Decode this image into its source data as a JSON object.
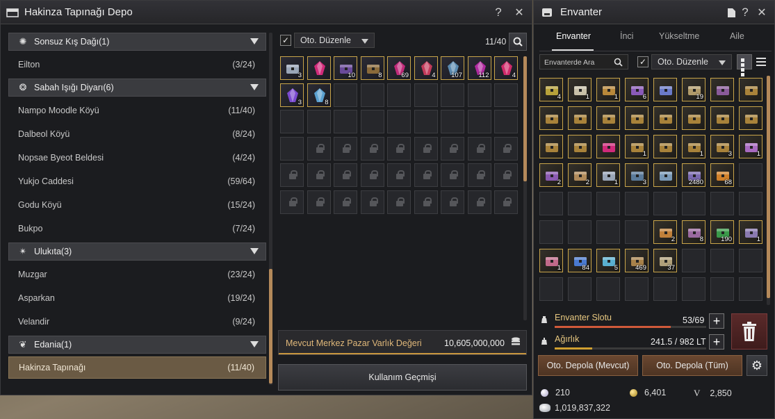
{
  "depo": {
    "title": "Hakinza Tapınağı Depo",
    "help_icon": "?",
    "close_icon": "✕",
    "regions": [
      {
        "name": "Sonsuz Kış Dağı(1)",
        "icon": "snowflake-icon",
        "cities": [
          {
            "name": "Eilton",
            "count": "(3/24)"
          }
        ]
      },
      {
        "name": "Sabah Işığı Diyarı(6)",
        "icon": "sun-emblem-icon",
        "cities": [
          {
            "name": "Nampo Moodle Köyü",
            "count": "(11/40)"
          },
          {
            "name": "Dalbeol Köyü",
            "count": "(8/24)"
          },
          {
            "name": "Nopsae Byeot Beldesi",
            "count": "(4/24)"
          },
          {
            "name": "Yukjo Caddesi",
            "count": "(59/64)"
          },
          {
            "name": "Godu Köyü",
            "count": "(15/24)"
          },
          {
            "name": "Bukpo",
            "count": "(7/24)"
          }
        ]
      },
      {
        "name": "Ulukıta(3)",
        "icon": "star-compass-icon",
        "cities": [
          {
            "name": "Muzgar",
            "count": "(23/24)"
          },
          {
            "name": "Asparkan",
            "count": "(19/24)"
          },
          {
            "name": "Velandir",
            "count": "(9/24)"
          }
        ]
      },
      {
        "name": "Edania(1)",
        "icon": "swirl-emblem-icon",
        "cities": [
          {
            "name": "Hakinza Tapınağı",
            "count": "(11/40)",
            "selected": true
          }
        ]
      }
    ],
    "auto_sort_label": "Oto. Düzenle",
    "slot_count": "11/40",
    "items": [
      {
        "qty": "3",
        "color": "#9aa6b8",
        "icon": "chest-icon"
      },
      {
        "qty": "",
        "color": "#d02a7a",
        "icon": "crystal-icon"
      },
      {
        "qty": "10",
        "color": "#6a4a9a",
        "icon": "box-icon"
      },
      {
        "qty": "8",
        "color": "#8a6a3a",
        "icon": "lantern-icon"
      },
      {
        "qty": "69",
        "color": "#c02a7a",
        "icon": "shard-icon"
      },
      {
        "qty": "4",
        "color": "#c23a5a",
        "icon": "crystal-icon"
      },
      {
        "qty": "107",
        "color": "#5a8ab0",
        "icon": "shard-icon"
      },
      {
        "qty": "112",
        "color": "#b02aa0",
        "icon": "shard-icon"
      },
      {
        "qty": "4",
        "color": "#d02a6a",
        "icon": "shard-icon"
      },
      {
        "qty": "3",
        "color": "#7a4ad0",
        "icon": "shard-icon"
      },
      {
        "qty": "8",
        "color": "#5aa0d0",
        "icon": "shard-icon"
      }
    ],
    "open_slots": 40,
    "unlocked_slots": 28,
    "market_value_label": "Mevcut Merkez Pazar Varlık Değeri",
    "market_value": "10,605,000,000",
    "history_button": "Kullanım Geçmişi"
  },
  "envanter": {
    "title": "Envanter",
    "tabs": [
      "Envanter",
      "İnci",
      "Yükseltme",
      "Aile"
    ],
    "search_placeholder": "Envanterde Ara",
    "auto_sort_label": "Oto. Düzenle",
    "items": [
      {
        "qty": "4",
        "color": "#b8a23a"
      },
      {
        "qty": "1",
        "color": "#c8c0a8"
      },
      {
        "qty": "1",
        "color": "#b8883a"
      },
      {
        "qty": "6",
        "color": "#8a5ab8"
      },
      {
        "qty": "",
        "color": "#6a7ac8"
      },
      {
        "qty": "19",
        "color": "#b09a6a"
      },
      {
        "qty": "",
        "color": "#8a5a9a"
      },
      {
        "qty": "",
        "color": "#a8823a"
      },
      {
        "qty": "",
        "color": "#a8823a"
      },
      {
        "qty": "",
        "color": "#a8823a"
      },
      {
        "qty": "",
        "color": "#a8823a"
      },
      {
        "qty": "",
        "color": "#a8823a"
      },
      {
        "qty": "",
        "color": "#a8823a"
      },
      {
        "qty": "",
        "color": "#a8823a"
      },
      {
        "qty": "",
        "color": "#a8823a"
      },
      {
        "qty": "",
        "color": "#a8823a"
      },
      {
        "qty": "",
        "color": "#a8823a"
      },
      {
        "qty": "",
        "color": "#a8823a"
      },
      {
        "qty": "",
        "color": "#d02a7a"
      },
      {
        "qty": "1",
        "color": "#a8823a"
      },
      {
        "qty": "",
        "color": "#a8823a"
      },
      {
        "qty": "1",
        "color": "#a8823a"
      },
      {
        "qty": "3",
        "color": "#a8823a"
      },
      {
        "qty": "1",
        "color": "#a86ac0"
      },
      {
        "qty": "2",
        "color": "#8a5ab0"
      },
      {
        "qty": "2",
        "color": "#b08a5a"
      },
      {
        "qty": "1",
        "color": "#9aa6b8"
      },
      {
        "qty": "3",
        "color": "#5a7a9a"
      },
      {
        "qty": "",
        "color": "#7a9ab8"
      },
      {
        "qty": "2480",
        "color": "#7a6ab0"
      },
      {
        "qty": "68",
        "color": "#d0802a"
      },
      {
        "qty": "",
        "color": ""
      },
      {
        "qty": "",
        "color": ""
      },
      {
        "qty": "",
        "color": ""
      },
      {
        "qty": "",
        "color": ""
      },
      {
        "qty": "",
        "color": ""
      },
      {
        "qty": "",
        "color": ""
      },
      {
        "qty": "",
        "color": ""
      },
      {
        "qty": "",
        "color": ""
      },
      {
        "qty": "",
        "color": ""
      },
      {
        "qty": "",
        "color": ""
      },
      {
        "qty": "",
        "color": ""
      },
      {
        "qty": "",
        "color": ""
      },
      {
        "qty": "",
        "color": ""
      },
      {
        "qty": "2",
        "color": "#c0803a"
      },
      {
        "qty": "8",
        "color": "#9a6aa0"
      },
      {
        "qty": "190",
        "color": "#3a9a4a"
      },
      {
        "qty": "1",
        "color": "#8a7ab0"
      },
      {
        "qty": "1",
        "color": "#c06a8a"
      },
      {
        "qty": "84",
        "color": "#4a7ad0"
      },
      {
        "qty": "5",
        "color": "#5ab0d0"
      },
      {
        "qty": "469",
        "color": "#a8824a"
      },
      {
        "qty": "37",
        "color": "#b0a07a"
      },
      {
        "qty": "",
        "color": ""
      },
      {
        "qty": "",
        "color": ""
      },
      {
        "qty": "",
        "color": ""
      }
    ],
    "slot_label": "Envanter Slotu",
    "slot_value": "53/69",
    "slot_fraction": 0.768,
    "weight_label": "Ağırlık",
    "weight_value": "241.5 / 982 LT",
    "weight_fraction": 0.246,
    "auto_depot_current": "Oto. Depola (Mevcut)",
    "auto_depot_all": "Oto. Depola (Tüm)",
    "pearl": "210",
    "gold_coin": "6,401",
    "valor": "2,850",
    "silver": "1,019,837,322",
    "valor_symbol": "V"
  },
  "colors": {
    "accent": "#b4895a",
    "slot_fill": "#d05a3a",
    "weight_fill": "#d0a030"
  }
}
